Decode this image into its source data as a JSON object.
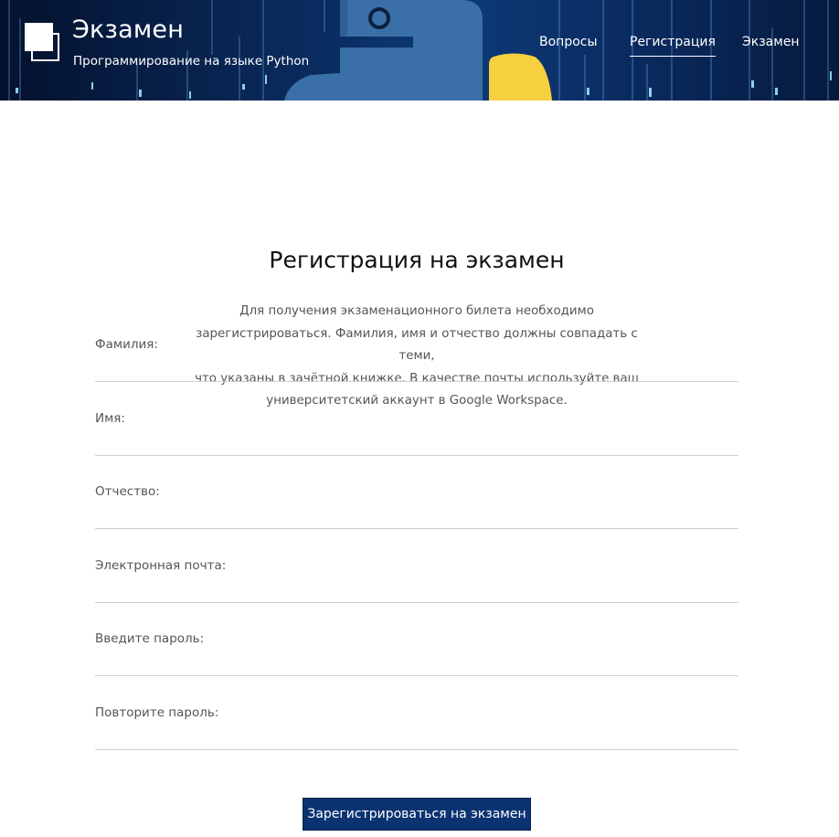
{
  "header": {
    "brand_title": "Экзамен",
    "brand_subtitle": "Программирование на языке Python",
    "nav": [
      {
        "label": "Вопросы",
        "active": false
      },
      {
        "label": "Регистрация",
        "active": true
      },
      {
        "label": "Экзамен",
        "active": false
      }
    ],
    "logo_icon": "python-logo-icon"
  },
  "main": {
    "title": "Регистрация на экзамен",
    "intro_lines": [
      "Для получения экзаменационного билета необходимо",
      "зарегистрироваться. Фамилия, имя и отчество должны совпадать с теми,",
      "что указаны в зачётной книжке. В качестве почты используйте ваш",
      "университетский аккаунт в Google Workspace."
    ],
    "fields": [
      {
        "label": "Фамилия:",
        "value": ""
      },
      {
        "label": "Имя:",
        "value": ""
      },
      {
        "label": "Отчество:",
        "value": ""
      },
      {
        "label": "Электронная почта:",
        "value": ""
      },
      {
        "label": "Введите пароль:",
        "value": ""
      },
      {
        "label": "Повторите пароль:",
        "value": ""
      }
    ],
    "submit_label": "Зарегистрироваться на экзамен"
  },
  "colors": {
    "header_bg": "#0a2a5c",
    "button_bg": "#0a3370",
    "python_blue": "#3a6fa8",
    "python_yellow": "#f6d03f"
  }
}
